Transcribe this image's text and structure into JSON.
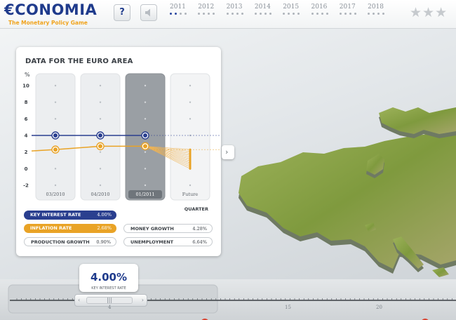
{
  "header": {
    "logo_text": "€CONOMIA",
    "logo_tagline": "The Monetary Policy Game",
    "help_label": "?",
    "years": [
      "2011",
      "2012",
      "2013",
      "2014",
      "2015",
      "2016",
      "2017",
      "2018"
    ],
    "current_year_index": 0,
    "quarters_played_current_year": 2,
    "rating_stars_visible": 3
  },
  "panel": {
    "title": "DATA FOR THE EURO AREA",
    "y_unit": "%",
    "x_axis_title": "QUARTER",
    "expand_label": "›"
  },
  "chart_data": {
    "type": "line",
    "title": "DATA FOR THE EURO AREA",
    "ylabel": "%",
    "xlabel": "QUARTER",
    "ylim": [
      -2,
      10
    ],
    "y_ticks": [
      "10",
      "8",
      "6",
      "4",
      "2",
      "0",
      "-2"
    ],
    "categories": [
      "03/2010",
      "04/2010",
      "01/2011",
      "Future"
    ],
    "selected_category": "01/2011",
    "series": [
      {
        "name": "KEY INTEREST RATE",
        "color": "#2a3f8f",
        "values": [
          4.0,
          4.0,
          4.0,
          null
        ]
      },
      {
        "name": "INFLATION RATE",
        "color": "#e9a326",
        "values": [
          2.3,
          2.7,
          2.7,
          null
        ]
      }
    ],
    "forecast_band": {
      "series": "INFLATION RATE",
      "from": 2.7,
      "to_low": 0.0,
      "to_high": 2.3
    },
    "grid": true
  },
  "indicators": [
    {
      "label": "KEY INTEREST RATE",
      "value": "4.00%",
      "style": "blue"
    },
    {
      "label": "INFLATION RATE",
      "value": "2.68%",
      "style": "orange"
    },
    {
      "label": "MONEY GROWTH",
      "value": "4.28%",
      "style": "plain"
    },
    {
      "label": "PRODUCTION GROWTH",
      "value": "0.90%",
      "style": "plain"
    },
    {
      "label": "UNEMPLOYMENT",
      "value": "6.64%",
      "style": "plain"
    }
  ],
  "timeline": {
    "key_rate_value": "4.00%",
    "key_rate_label": "KEY INTEREST RATE",
    "slider_grip": "|||",
    "slider_left": "‹",
    "slider_right": "›",
    "tick_labels": [
      "4",
      "15",
      "20"
    ]
  },
  "colors": {
    "brand_blue": "#1f3b8c",
    "accent_orange": "#f0a31c",
    "land_green": "#8aa24a"
  }
}
